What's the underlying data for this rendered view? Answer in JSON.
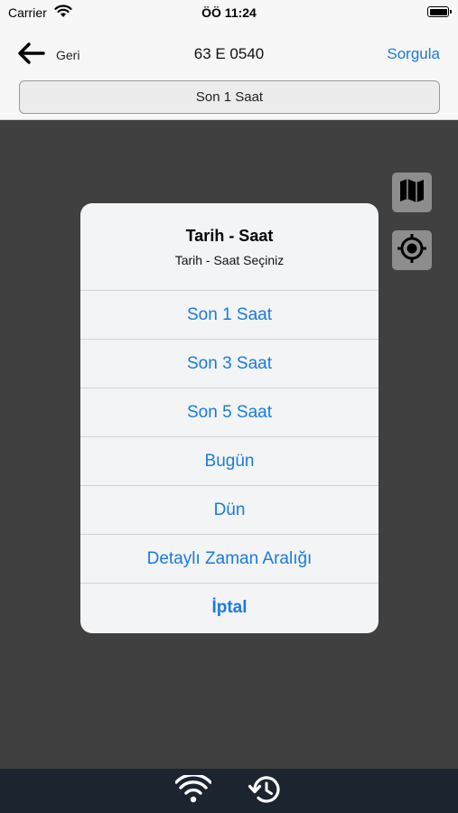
{
  "status_bar": {
    "carrier": "Carrier",
    "time": "ÖÖ 11:24"
  },
  "nav": {
    "back_label": "Geri",
    "title": "63 E 0540",
    "action_label": "Sorgula"
  },
  "range_selector": {
    "label": "Son 1 Saat"
  },
  "alert": {
    "title": "Tarih - Saat",
    "message": "Tarih - Saat Seçiniz",
    "actions": [
      "Son 1 Saat",
      "Son 3 Saat",
      "Son 5 Saat",
      "Bugün",
      "Dün",
      "Detaylı Zaman Aralığı"
    ],
    "cancel_label": "İptal"
  },
  "colors": {
    "accent": "#1a7be0",
    "map_overlay": "#404040",
    "tab_bar": "#1c2430"
  },
  "icons": [
    "wifi-icon",
    "battery-icon",
    "back-arrow-icon",
    "map-icon",
    "location-target-icon",
    "wifi-icon",
    "history-icon"
  ]
}
